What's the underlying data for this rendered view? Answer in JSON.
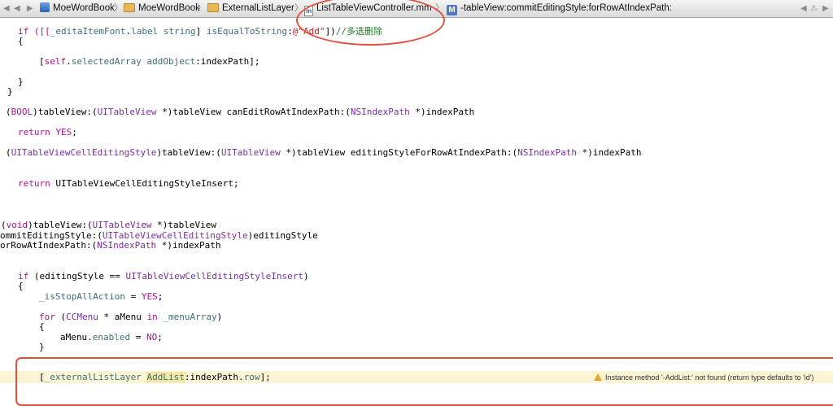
{
  "jumpbar": {
    "crumbs": [
      "MoeWordBook",
      "MoeWordBook",
      "ExternalListLayer",
      "ListTableViewController.mm",
      "-tableView:commitEditingStyle:forRowAtIndexPath:"
    ],
    "file_badge": "m",
    "method_badge": "M"
  },
  "code": {
    "l1": {
      "a": "if ([[",
      "b": "_editaItemFont",
      "c": ".",
      "d": "label",
      "e": " ",
      "f": "string",
      "g": "] ",
      "h": "isEqualToString",
      "i": ":",
      "j": "@\"Add\"",
      "k": "])",
      "l": "//多选删除"
    },
    "l2": "{",
    "l3": {
      "a": "[",
      "b": "self",
      "c": ".",
      "d": "selectedArray",
      "e": " ",
      "f": "addObject",
      "g": ":indexPath];"
    },
    "l4": "}",
    "l5": "}",
    "l6": {
      "a": "(",
      "b": "BOOL",
      "c": ")tableView:(",
      "d": "UITableView",
      "e": " *)tableView canEditRowAtIndexPath:(",
      "f": "NSIndexPath",
      "g": " *)indexPath"
    },
    "l7": {
      "a": "return",
      "b": " ",
      "c": "YES",
      "d": ";"
    },
    "l8": {
      "a": "(",
      "b": "UITableViewCellEditingStyle",
      "c": ")tableView:(",
      "d": "UITableView",
      "e": " *)tableView editingStyleForRowAtIndexPath:(",
      "f": "NSIndexPath",
      "g": " *)indexPath"
    },
    "l9": {
      "a": "return",
      "b": " ",
      "c": "UITableViewCellEditingStyleInsert",
      "d": ";"
    },
    "l10": {
      "a": "(",
      "b": "void",
      "c": ")tableView:(",
      "d": "UITableView",
      "e": " *)tableView"
    },
    "l11": {
      "a": "ommitEditingStyle:(",
      "b": "UITableViewCellEditingStyle",
      "c": ")editingStyle"
    },
    "l12": {
      "a": "orRowAtIndexPath:(",
      "b": "NSIndexPath",
      "c": " *)indexPath"
    },
    "l13": {
      "a": "if",
      "b": " (editingStyle == ",
      "c": "UITableViewCellEditingStyleInsert",
      "d": ")"
    },
    "l14": "{",
    "l15": {
      "a": "_isStopAllAction",
      "b": " = ",
      "c": "YES",
      "d": ";"
    },
    "l16": {
      "a": "for",
      "b": " (",
      "c": "CCMenu",
      "d": " * aMenu ",
      "e": "in",
      "f": " ",
      "g": "_menuArray",
      "h": ")"
    },
    "l17": "{",
    "l18": {
      "a": "aMenu.",
      "b": "enabled",
      "c": " = ",
      "d": "NO",
      "e": ";"
    },
    "l19": "}",
    "l20": {
      "a": "[",
      "b": "_externalListLayer",
      "c": " ",
      "d": "AddList",
      "e": ":indexPath.",
      "f": "row",
      "g": "];"
    }
  },
  "warning": "Instance method '-AddList:' not found (return type defaults to 'id')"
}
